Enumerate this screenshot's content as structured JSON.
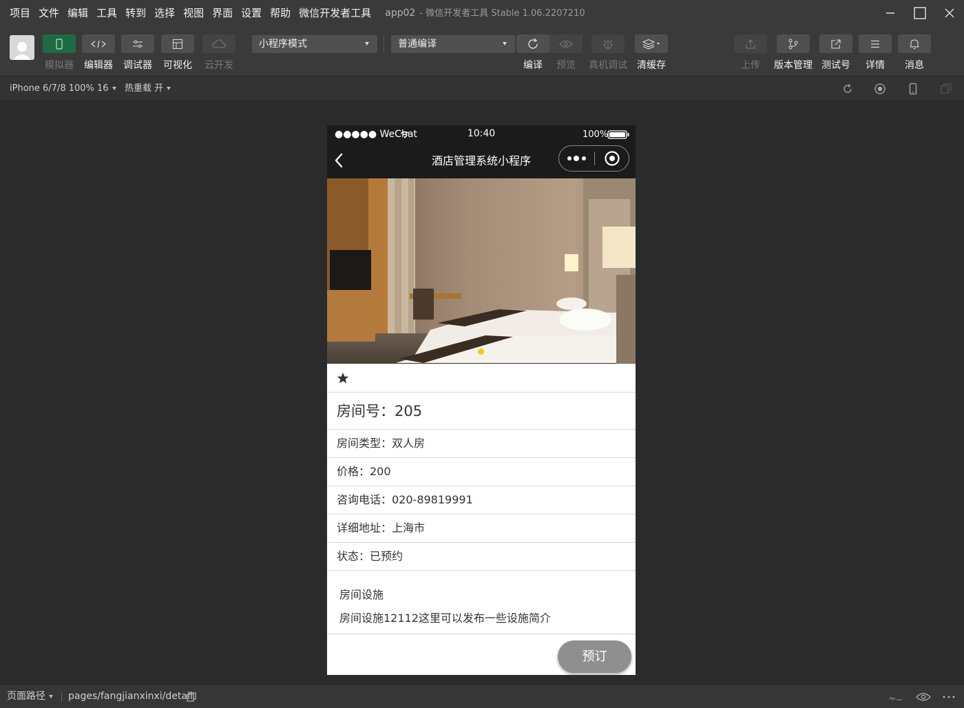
{
  "menu": [
    "项目",
    "文件",
    "编辑",
    "工具",
    "转到",
    "选择",
    "视图",
    "界面",
    "设置",
    "帮助",
    "微信开发者工具"
  ],
  "window": {
    "app_name": "app02",
    "title": "- 微信开发者工具 Stable 1.06.2207210"
  },
  "toolbar": {
    "left_tools": [
      {
        "label": "模拟器",
        "icon": "phone-icon",
        "state": "active"
      },
      {
        "label": "编辑器",
        "icon": "code-icon",
        "state": "normal"
      },
      {
        "label": "调试器",
        "icon": "debug-icon",
        "state": "normal"
      },
      {
        "label": "可视化",
        "icon": "layout-icon",
        "state": "normal"
      },
      {
        "label": "云开发",
        "icon": "cloud-icon",
        "state": "disabled"
      }
    ],
    "mode_select": "小程序模式",
    "compile_select": "普通编译",
    "mid_tools": [
      {
        "label": "编译",
        "icon": "refresh-icon",
        "state": "normal"
      },
      {
        "label": "预览",
        "icon": "eye-icon",
        "state": "disabled"
      },
      {
        "label": "真机调试",
        "icon": "bug-icon",
        "state": "disabled"
      },
      {
        "label": "清缓存",
        "icon": "layers-icon",
        "state": "normal"
      }
    ],
    "right_tools": [
      {
        "label": "上传",
        "icon": "upload-icon",
        "state": "disabled"
      },
      {
        "label": "版本管理",
        "icon": "branch-icon",
        "state": "normal"
      },
      {
        "label": "测试号",
        "icon": "external-link-icon",
        "state": "normal"
      },
      {
        "label": "详情",
        "icon": "menu-icon",
        "state": "normal"
      },
      {
        "label": "消息",
        "icon": "bell-icon",
        "state": "normal"
      }
    ]
  },
  "subbar": {
    "device": "iPhone 6/7/8 100% 16",
    "hot_reload": "热重载 开"
  },
  "phone": {
    "status": {
      "carrier": "●●●●● WeChat",
      "time": "10:40",
      "battery": "100%"
    },
    "nav_title": "酒店管理系统小程序",
    "room_number": "房间号：205",
    "details": [
      "房间类型：双人房",
      "价格：200",
      "咨询电话：020-89819991",
      "详细地址：上海市",
      "状态：已预约"
    ],
    "facility_title": "房间设施",
    "facility_desc": "房间设施12112这里可以发布一些设施简介",
    "book_label": "预订"
  },
  "bottombar": {
    "path_label": "页面路径",
    "path": "pages/fangjianxinxi/detail"
  },
  "colors": {
    "accent_green": "#1f6a43",
    "indicator": "#f5c518",
    "book_button": "#8f8f8f"
  }
}
